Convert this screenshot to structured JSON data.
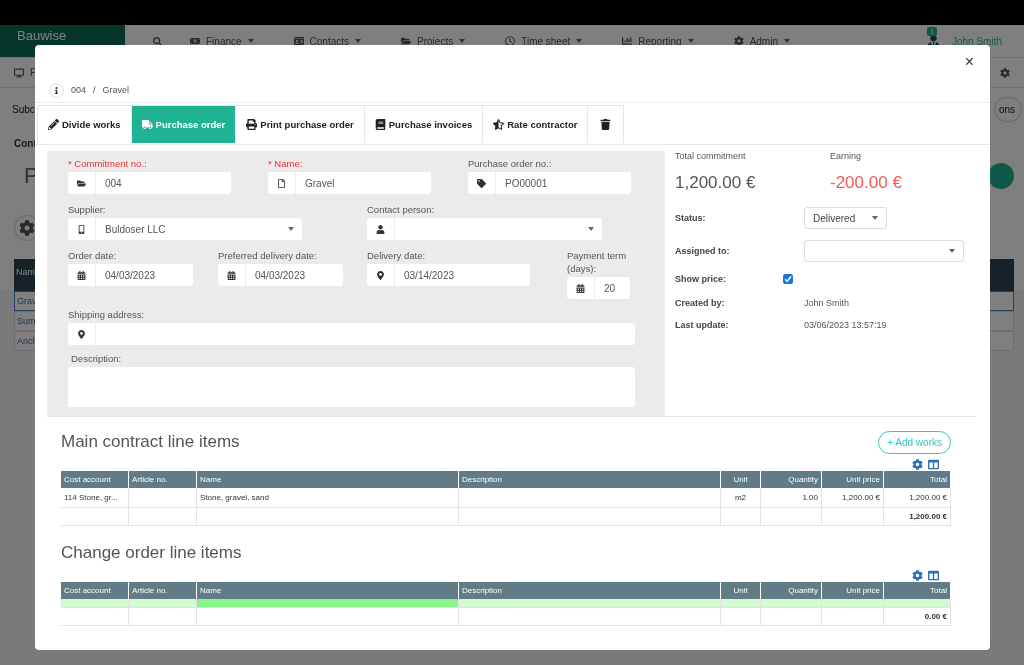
{
  "background": {
    "brand": "Bauwise",
    "nav": [
      {
        "label": "Finance"
      },
      {
        "label": "Contacts"
      },
      {
        "label": "Projects"
      },
      {
        "label": "Time sheet"
      },
      {
        "label": "Reporting"
      },
      {
        "label": "Admin"
      }
    ],
    "notification_count": "1",
    "user": "John Smith",
    "subbar_text": "P",
    "section_text": "Subc",
    "right_button": "ons",
    "content_heading": "Cont",
    "page_title": "P",
    "table_header": "Nam",
    "table_rows": [
      {
        "text": "Grav",
        "selected": true
      },
      {
        "text": "Sum",
        "selected": false
      },
      {
        "text": "Ancl",
        "selected": false
      }
    ]
  },
  "modal": {
    "breadcrumb": [
      "004",
      "Gravel"
    ],
    "breadcrumb_separator": "/",
    "close_label": "×",
    "tabs": [
      {
        "label": "Divide works",
        "selected": false
      },
      {
        "label": "Purchase order",
        "selected": true
      },
      {
        "label": "Print purchase order",
        "selected": false
      },
      {
        "label": "Purchase invoices",
        "selected": false
      },
      {
        "label": "Rate contractor",
        "selected": false
      },
      {
        "kind": "delete",
        "selected": false
      }
    ],
    "form": {
      "commitment_no": {
        "label": "* Commitment no.:",
        "required": true,
        "value": "004"
      },
      "name": {
        "label": "* Name:",
        "required": true,
        "value": "Gravel"
      },
      "purchase_order_no": {
        "label": "Purchase order no.:",
        "required": false,
        "value": "PO00001"
      },
      "supplier": {
        "label": "Supplier:",
        "value": "Buldoser LLC"
      },
      "contact_person": {
        "label": "Contact person:"
      },
      "order_date": {
        "label": "Order date:",
        "value": "04/03/2023"
      },
      "preferred_delivery_date": {
        "label": "Preferred delivery date:",
        "value": "04/03/2023"
      },
      "delivery_date": {
        "label": "Delivery date:",
        "value": "03/14/2023"
      },
      "payment_term": {
        "label": "Payment term (days):",
        "value": "20"
      },
      "shipping_address": {
        "label": "Shipping address:"
      },
      "description": {
        "label": "Description:"
      }
    },
    "info": {
      "total_commitment": {
        "label": "Total commitment",
        "value": "1,200.00 €"
      },
      "earning": {
        "label": "Earning",
        "value": "-200.00 €",
        "negative": true
      },
      "status": {
        "label": "Status:",
        "value": "Delivered"
      },
      "assigned_to": {
        "label": "Assigned to:"
      },
      "show_price": {
        "label": "Show price:",
        "checked": true
      },
      "created_by": {
        "label": "Created by:",
        "value": "John Smith"
      },
      "last_update": {
        "label": "Last update:",
        "value": "03/06/2023 13:57:19"
      }
    },
    "sections": [
      {
        "title": "Main contract line items",
        "add_button": "+ Add works",
        "columns": [
          "Cost account",
          "Article no.",
          "Name",
          "Description",
          "Unit",
          "Quantity",
          "Unit price",
          "Total"
        ],
        "rows": [
          {
            "kind": "item",
            "cells": [
              {
                "text": "114 Stone, gr..."
              },
              {},
              {
                "text": "Stone, gravel, sand"
              },
              {},
              {
                "text": "m2"
              },
              {
                "text": "1.00"
              },
              {
                "text": "1,200.00 €"
              },
              {
                "text": "1,200.00 €"
              }
            ]
          },
          {
            "kind": "total",
            "cells": [
              {},
              {},
              {},
              {},
              {},
              {},
              {},
              {
                "text": "1,200.00 €"
              }
            ]
          }
        ]
      },
      {
        "title": "Change order line items",
        "columns": [
          "Cost account",
          "Article no.",
          "Name",
          "Description",
          "Unit",
          "Quantity",
          "Unit price",
          "Total"
        ],
        "rows": [
          {
            "kind": "draft",
            "cells": [
              {
                "selected": false
              },
              {
                "selected": false
              },
              {
                "selected": true
              },
              {
                "selected": false
              },
              {
                "selected": false
              },
              {
                "selected": false
              },
              {
                "selected": false
              },
              {
                "selected": false
              }
            ]
          },
          {
            "kind": "total",
            "cells": [
              {},
              {},
              {},
              {},
              {},
              {},
              {},
              {
                "text": "0.00 €"
              }
            ]
          }
        ]
      }
    ]
  }
}
